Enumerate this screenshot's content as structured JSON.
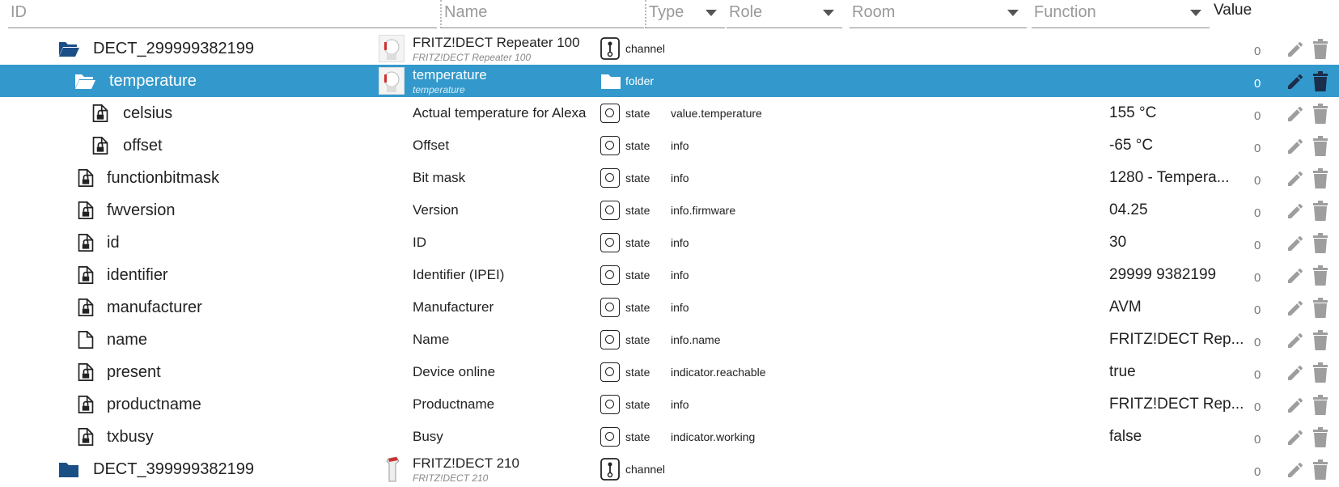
{
  "header": {
    "id_placeholder": "ID",
    "name_placeholder": "Name",
    "type_placeholder": "Type",
    "role_placeholder": "Role",
    "room_placeholder": "Room",
    "function_placeholder": "Function",
    "value_label": "Value"
  },
  "colors": {
    "selected_row": "#3399cc",
    "folder_blue": "#1a4f86",
    "icon_grey": "#9e9e9e"
  },
  "rows": [
    {
      "id": "DECT_299999382199",
      "icon": "folder-open-icon",
      "name": "FRITZ!DECT Repeater 100",
      "name_sub": "FRITZ!DECT Repeater 100",
      "type": "channel",
      "type_icon": "channel-icon",
      "role": "",
      "value": "",
      "ack": "0"
    },
    {
      "id": "temperature",
      "icon": "folder-open-icon",
      "name": "temperature",
      "name_sub": "temperature",
      "type": "folder",
      "type_icon": "folder-icon",
      "role": "",
      "value": "",
      "ack": "0",
      "selected": true
    },
    {
      "id": "celsius",
      "icon": "file-lock-icon",
      "name": "Actual temperature for Alexa",
      "type": "state",
      "type_icon": "state-icon",
      "role": "value.temperature",
      "value": "155 °C",
      "ack": "0"
    },
    {
      "id": "offset",
      "icon": "file-lock-icon",
      "name": "Offset",
      "type": "state",
      "type_icon": "state-icon",
      "role": "info",
      "value": "-65 °C",
      "ack": "0"
    },
    {
      "id": "functionbitmask",
      "icon": "file-lock-icon",
      "name": "Bit mask",
      "type": "state",
      "type_icon": "state-icon",
      "role": "info",
      "value": "1280 - Tempera...",
      "ack": "0"
    },
    {
      "id": "fwversion",
      "icon": "file-lock-icon",
      "name": "Version",
      "type": "state",
      "type_icon": "state-icon",
      "role": "info.firmware",
      "value": "04.25",
      "ack": "0"
    },
    {
      "id": "id",
      "icon": "file-lock-icon",
      "name": "ID",
      "type": "state",
      "type_icon": "state-icon",
      "role": "info",
      "value": "30",
      "ack": "0"
    },
    {
      "id": "identifier",
      "icon": "file-lock-icon",
      "name": "Identifier (IPEI)",
      "type": "state",
      "type_icon": "state-icon",
      "role": "info",
      "value": "29999 9382199",
      "ack": "0"
    },
    {
      "id": "manufacturer",
      "icon": "file-lock-icon",
      "name": "Manufacturer",
      "type": "state",
      "type_icon": "state-icon",
      "role": "info",
      "value": "AVM",
      "ack": "0"
    },
    {
      "id": "name",
      "icon": "file-icon",
      "name": "Name",
      "type": "state",
      "type_icon": "state-icon",
      "role": "info.name",
      "value": "FRITZ!DECT Rep...",
      "ack": "0"
    },
    {
      "id": "present",
      "icon": "file-lock-icon",
      "name": "Device online",
      "type": "state",
      "type_icon": "state-icon",
      "role": "indicator.reachable",
      "value": "true",
      "ack": "0"
    },
    {
      "id": "productname",
      "icon": "file-lock-icon",
      "name": "Productname",
      "type": "state",
      "type_icon": "state-icon",
      "role": "info",
      "value": "FRITZ!DECT Rep...",
      "ack": "0"
    },
    {
      "id": "txbusy",
      "icon": "file-lock-icon",
      "name": "Busy",
      "type": "state",
      "type_icon": "state-icon",
      "role": "indicator.working",
      "value": "false",
      "ack": "0"
    },
    {
      "id": "DECT_399999382199",
      "icon": "folder-closed-icon",
      "name": "FRITZ!DECT 210",
      "name_sub": "FRITZ!DECT 210",
      "type": "channel",
      "type_icon": "channel-icon",
      "role": "",
      "value": "",
      "ack": "0"
    }
  ]
}
